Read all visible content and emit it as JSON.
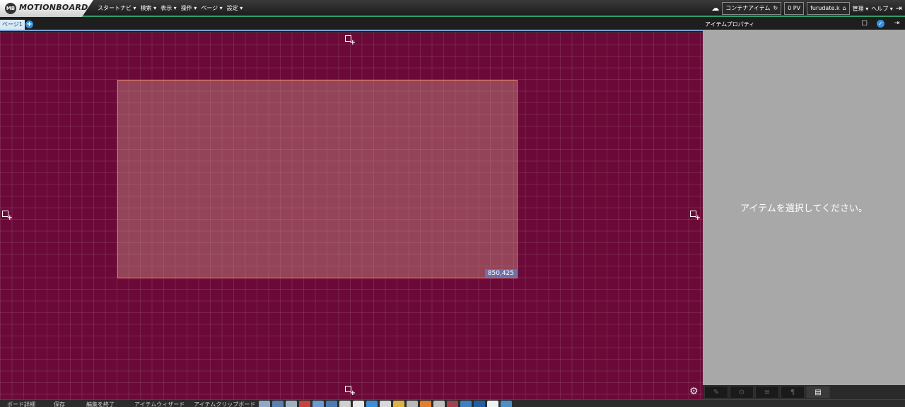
{
  "app": {
    "logo_badge": "MB",
    "logo_text": "MOTIONBOARD"
  },
  "menu": [
    "スタートナビ ▾",
    "検索 ▾",
    "表示 ▾",
    "操作 ▾",
    "ページ ▾",
    "設定 ▾"
  ],
  "toolbar": {
    "container_item": "コンテナアイテム",
    "pv": "0 PV",
    "user": "furudate.k",
    "admin": "管理 ▾",
    "help": "ヘルプ ▾"
  },
  "tabs": {
    "page1": "ページ1",
    "add": "+"
  },
  "canvas": {
    "size_label": "850,425",
    "color": "#6b0a38"
  },
  "panel": {
    "title": "アイテムプロパティ",
    "message": "アイテムを選択してください。"
  },
  "bottom": {
    "btn1": "ボード詳細",
    "btn2": "保存",
    "btn3": "編集を終了",
    "btn4": "アイテムウィザード",
    "btn5": "アイテムクリップボード"
  },
  "icons": {
    "refresh": "refresh-icon",
    "home": "home-icon",
    "logout": "logout-icon",
    "gear": "gear-icon"
  }
}
